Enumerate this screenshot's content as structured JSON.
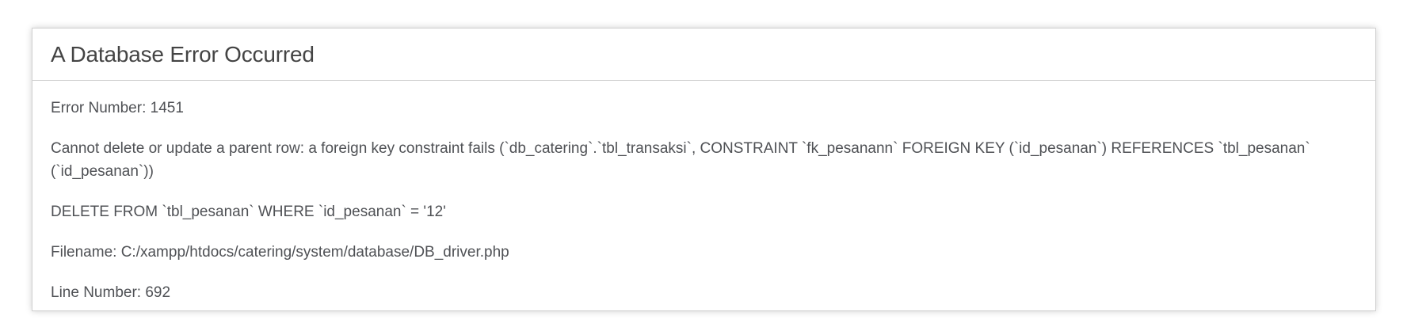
{
  "error": {
    "title": "A Database Error Occurred",
    "error_number": "Error Number: 1451",
    "message": "Cannot delete or update a parent row: a foreign key constraint fails (`db_catering`.`tbl_transaksi`, CONSTRAINT `fk_pesanann` FOREIGN KEY (`id_pesanan`) REFERENCES `tbl_pesanan` (`id_pesanan`))",
    "query": "DELETE FROM `tbl_pesanan` WHERE `id_pesanan` = '12'",
    "filename": "Filename: C:/xampp/htdocs/catering/system/database/DB_driver.php",
    "line_number": "Line Number: 692"
  }
}
